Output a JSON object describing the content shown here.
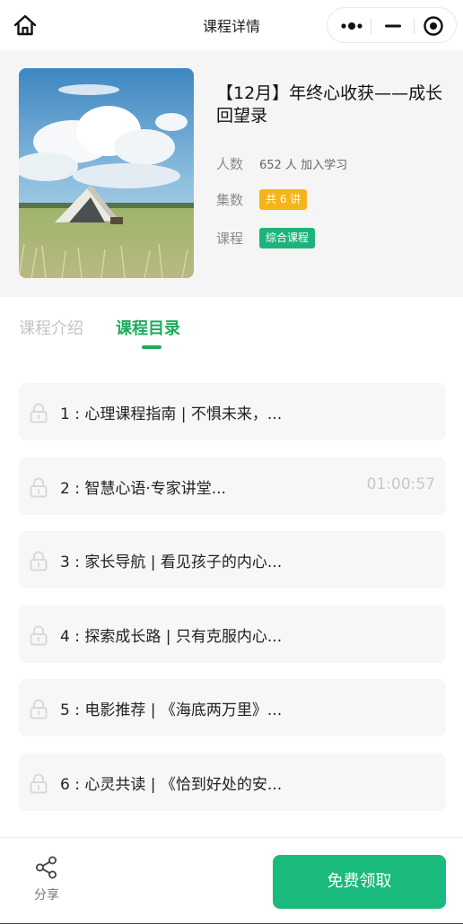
{
  "nav": {
    "title": "课程详情",
    "home_icon": "home-icon",
    "more_icon": "more-dots-icon",
    "minimize_icon": "minimize-icon",
    "close_icon": "target-close-icon"
  },
  "course": {
    "title": "【12月】年终心收获——成长回望录",
    "cover": "tent-in-meadow-photo",
    "learners_label": "人数",
    "learners_value": "652 人 加入学习",
    "episodes_label": "集数",
    "episodes_value": "共 6 讲",
    "type_label": "课程",
    "type_value": "综合课程"
  },
  "tabs": [
    {
      "label": "课程介绍",
      "active": false
    },
    {
      "label": "课程目录",
      "active": true
    }
  ],
  "lessons": [
    {
      "title": "1 : 心理课程指南 | 不惧未来，...",
      "duration": ""
    },
    {
      "title": "2 : 智慧心语·专家讲堂...",
      "duration": "01:00:57"
    },
    {
      "title": "3 : 家长导航 | 看见孩子的内心...",
      "duration": ""
    },
    {
      "title": "4 : 探索成长路 | 只有克服内心...",
      "duration": ""
    },
    {
      "title": "5 : 电影推荐 | 《海底两万里》...",
      "duration": ""
    },
    {
      "title": "6 : 心灵共读 | 《恰到好处的安...",
      "duration": ""
    }
  ],
  "bottom": {
    "share_label": "分享",
    "claim_label": "免费领取"
  },
  "colors": {
    "accent_green": "#1aad5c",
    "button_green": "#1ab97c",
    "badge_yellow": "#f5b518",
    "badge_green": "#1db37b"
  }
}
